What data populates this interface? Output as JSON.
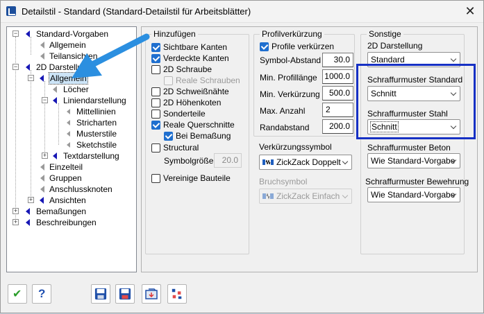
{
  "window": {
    "title": "Detailstil - Standard (Standard-Detailstil für Arbeitsblätter)",
    "close_glyph": "✕"
  },
  "tree": {
    "items": [
      {
        "label": "Standard-Vorgaben",
        "icon": "blue-triangle-icon"
      },
      {
        "label": "Allgemein",
        "icon": "grey-triangle-icon"
      },
      {
        "label": "Teilansichten",
        "icon": "grey-triangle-icon"
      },
      {
        "label": "2D Darstellung",
        "icon": "blue-triangle-icon"
      },
      {
        "label": "Allgemein",
        "icon": "blue-triangle-icon",
        "selected": true
      },
      {
        "label": "Löcher",
        "icon": "grey-triangle-icon"
      },
      {
        "label": "Liniendarstellung",
        "icon": "blue-triangle-icon"
      },
      {
        "label": "Mittellinien",
        "icon": "grey-triangle-icon"
      },
      {
        "label": "Stricharten",
        "icon": "grey-triangle-icon"
      },
      {
        "label": "Musterstile",
        "icon": "grey-triangle-icon"
      },
      {
        "label": "Sketchstile",
        "icon": "grey-triangle-icon"
      },
      {
        "label": "Textdarstellung",
        "icon": "blue-triangle-icon"
      },
      {
        "label": "Einzelteil",
        "icon": "grey-triangle-icon"
      },
      {
        "label": "Gruppen",
        "icon": "grey-triangle-icon"
      },
      {
        "label": "Anschlussknoten",
        "icon": "grey-triangle-icon"
      },
      {
        "label": "Ansichten",
        "icon": "blue-triangle-icon"
      },
      {
        "label": "Bemaßungen",
        "icon": "blue-triangle-icon"
      },
      {
        "label": "Beschreibungen",
        "icon": "blue-triangle-icon"
      }
    ]
  },
  "hinzufuegen": {
    "title": "Hinzufügen",
    "options": [
      {
        "label": "Sichtbare Kanten",
        "checked": true,
        "enabled": true
      },
      {
        "label": "Verdeckte Kanten",
        "checked": true,
        "enabled": true
      },
      {
        "label": "2D Schraube",
        "checked": false,
        "enabled": true
      },
      {
        "label": "Reale Schrauben",
        "checked": false,
        "enabled": false
      },
      {
        "label": "2D Schweißnähte",
        "checked": false,
        "enabled": true
      },
      {
        "label": "2D Höhenkoten",
        "checked": false,
        "enabled": true
      },
      {
        "label": "Sonderteile",
        "checked": false,
        "enabled": true
      },
      {
        "label": "Reale Querschnitte",
        "checked": true,
        "enabled": true
      },
      {
        "label": "Bei Bemaßung",
        "checked": true,
        "enabled": true
      },
      {
        "label": "Structural",
        "checked": false,
        "enabled": true
      },
      {
        "label": "Vereinige Bauteile",
        "checked": false,
        "enabled": true
      }
    ],
    "symbolgroesse_label": "Symbolgröße",
    "symbolgroesse_value": "20.0"
  },
  "profilverkuerzung": {
    "title": "Profilverkürzung",
    "checkbox_label": "Profile verkürzen",
    "checked": true,
    "fields": [
      {
        "label": "Symbol-Abstand",
        "value": "30.0"
      },
      {
        "label": "Min. Profillänge",
        "value": "1000.0"
      },
      {
        "label": "Min. Verkürzung",
        "value": "500.0"
      },
      {
        "label": "Max. Anzahl",
        "value": "2"
      },
      {
        "label": "Randabstand",
        "value": "200.0"
      }
    ],
    "verkuerzungssymbol_label": "Verkürzungssymbol",
    "verkuerzungssymbol_value": "ZickZack Doppelt",
    "bruchsymbol_label": "Bruchsymbol",
    "bruchsymbol_value": "ZickZack Einfach"
  },
  "sonstige": {
    "title": "Sonstige",
    "darstellung_label": "2D Darstellung",
    "darstellung_value": "Standard",
    "standard_label": "Schraffurmuster Standard",
    "standard_value": "Schnitt",
    "stahl_label": "Schraffurmuster Stahl",
    "stahl_value": "Schnitt",
    "beton_label": "Schraffurmuster Beton",
    "beton_value": "Wie Standard-Vorgabe",
    "bewehrung_label": "Schraffurmuster Bewehrung",
    "bewehrung_value": "Wie Standard-Vorgabe"
  },
  "toolbar": {
    "buttons": [
      "ok-check-icon",
      "help-icon",
      "save-icon",
      "save-as-icon",
      "load-icon",
      "compare-icon"
    ],
    "help_glyph": "?",
    "ok_glyph": "✔"
  },
  "colors": {
    "annotation_arrow": "#2b8fe0",
    "highlight_box": "#1630c4",
    "tree_icon_blue": "#1717b5"
  }
}
